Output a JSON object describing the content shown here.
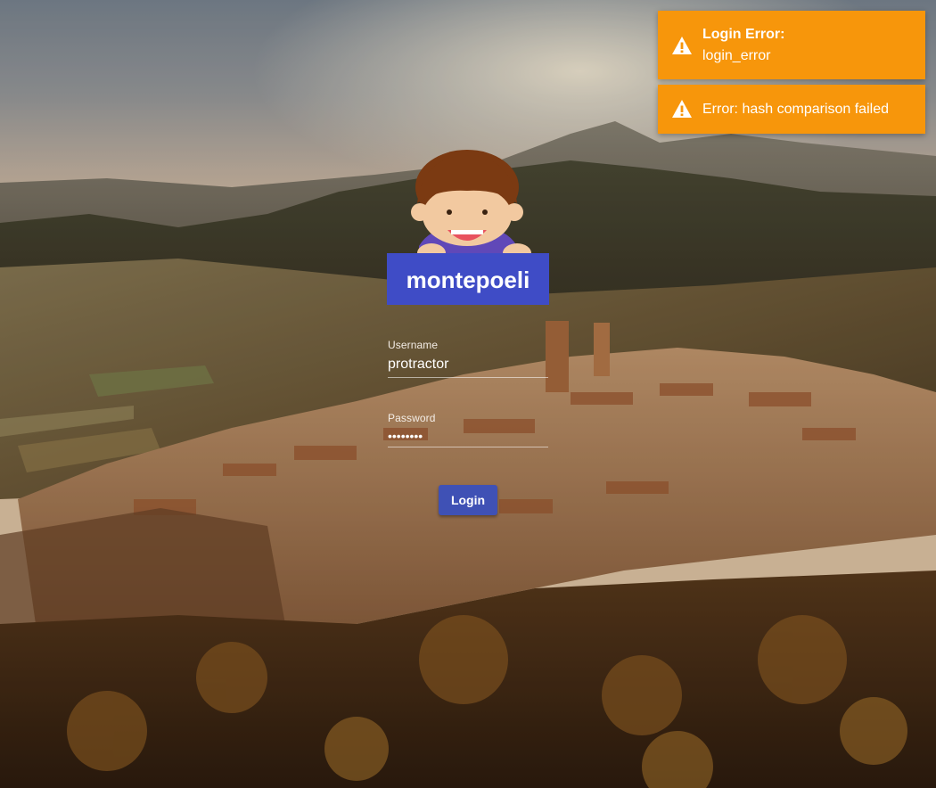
{
  "brand": {
    "logo_text": "montepoeli",
    "logo_bg_color": "#3f4cc6",
    "logo_icon": "girl-mascot-icon"
  },
  "login_form": {
    "username_label": "Username",
    "username_value": "protractor",
    "password_label": "Password",
    "password_value": "••••••••",
    "submit_label": "Login",
    "button_color": "#3f51b5"
  },
  "toasts": [
    {
      "icon": "warning-icon",
      "title": "Login Error:",
      "message": "login_error"
    },
    {
      "icon": "warning-icon",
      "title": "",
      "message": "Error: hash comparison failed"
    }
  ],
  "colors": {
    "toast_bg": "#f7960b",
    "text_on_toast": "#ffffff"
  }
}
